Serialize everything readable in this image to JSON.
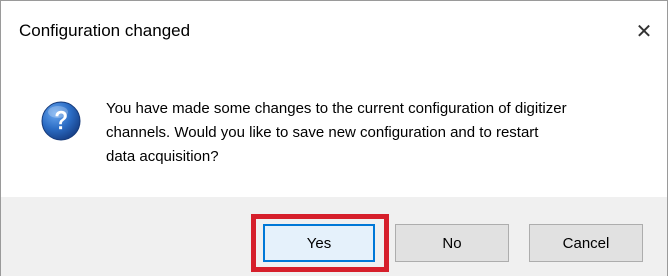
{
  "dialog": {
    "title": "Configuration changed",
    "close_symbol": "✕",
    "icon": "question-icon",
    "message_lines": [
      "You have made some changes to the current configuration of digitizer",
      "channels. Would you like to save new configuration and to restart",
      "data acquisition?"
    ],
    "buttons": {
      "yes": "Yes",
      "no": "No",
      "cancel": "Cancel"
    },
    "highlight_color": "#d61f2b",
    "accent_color": "#0078d7"
  }
}
